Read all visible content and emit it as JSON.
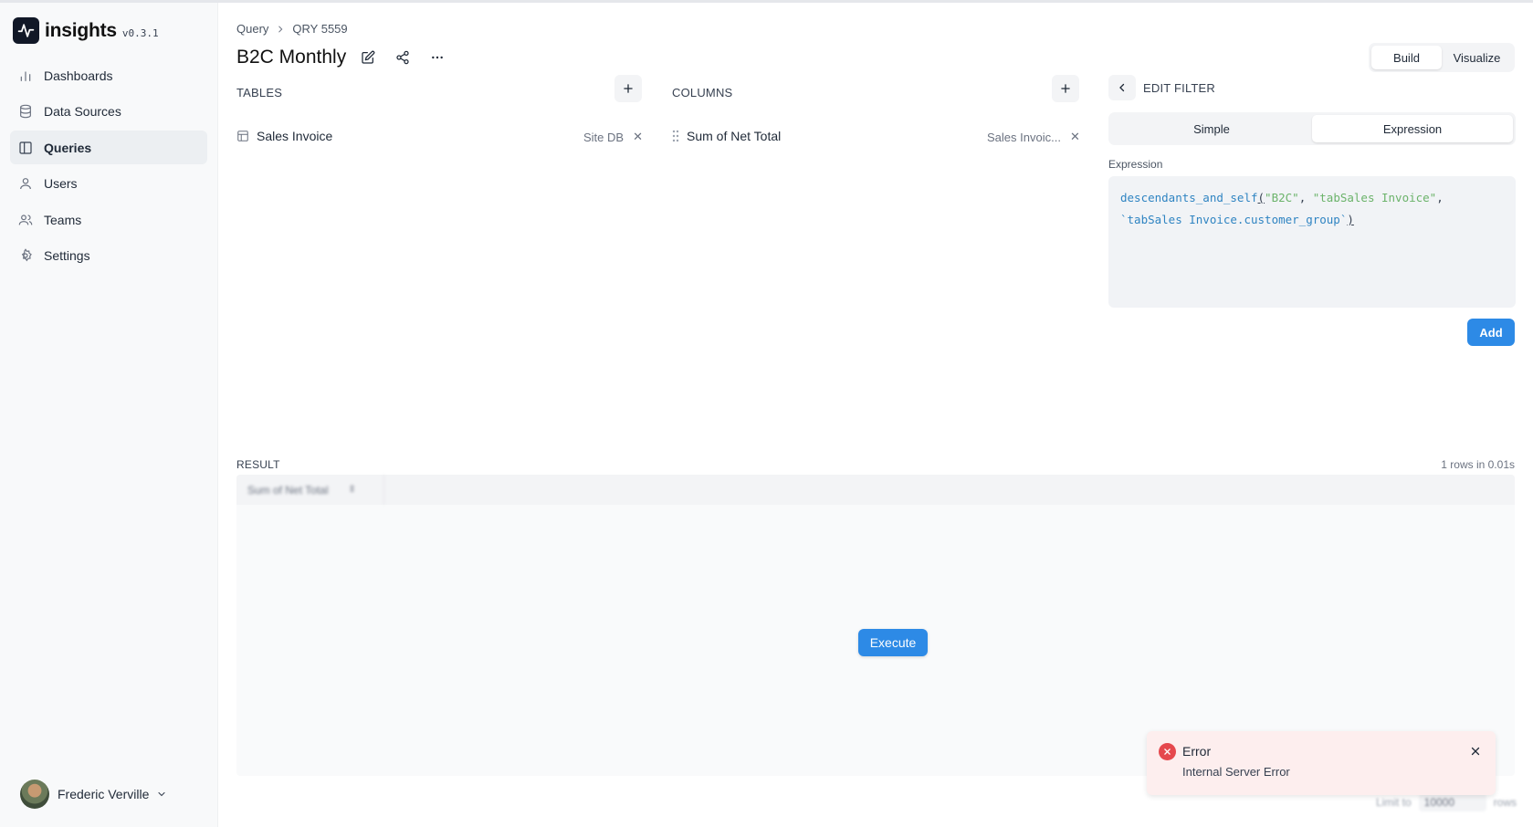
{
  "app": {
    "name": "insights",
    "version": "v0.3.1"
  },
  "sidebar": {
    "items": [
      {
        "label": "Dashboards",
        "icon": "bar-chart-icon"
      },
      {
        "label": "Data Sources",
        "icon": "database-icon"
      },
      {
        "label": "Queries",
        "icon": "columns-icon",
        "active": true
      },
      {
        "label": "Users",
        "icon": "user-icon"
      },
      {
        "label": "Teams",
        "icon": "users-icon"
      },
      {
        "label": "Settings",
        "icon": "gear-icon"
      }
    ],
    "user": {
      "name": "Frederic Verville"
    }
  },
  "header": {
    "breadcrumb": [
      "Query",
      "QRY 5559"
    ],
    "title": "B2C Monthly",
    "view_toggle": {
      "options": [
        "Build",
        "Visualize"
      ],
      "selected": "Build"
    }
  },
  "tables": {
    "label": "TABLES",
    "items": [
      {
        "name": "Sales Invoice",
        "source": "Site DB"
      }
    ]
  },
  "columns": {
    "label": "COLUMNS",
    "items": [
      {
        "name": "Sum of Net Total",
        "table": "Sales Invoic..."
      }
    ]
  },
  "filter": {
    "title": "EDIT FILTER",
    "tabs": [
      "Simple",
      "Expression"
    ],
    "selected_tab": "Expression",
    "expression_label": "Expression",
    "expression_fn": "descendants_and_self",
    "expression_args": [
      "\"B2C\"",
      "\"tabSales Invoice\"",
      "`tabSales Invoice.customer_group`"
    ],
    "add_label": "Add"
  },
  "result": {
    "label": "RESULT",
    "meta": "1 rows in 0.01s",
    "columns": [
      "Sum of Net Total"
    ],
    "execute_label": "Execute",
    "limit_prefix": "Limit to",
    "limit_value": "10000",
    "limit_suffix": "rows"
  },
  "toast": {
    "title": "Error",
    "message": "Internal Server Error",
    "color": "#e5484d"
  },
  "colors": {
    "accent": "#2d8ae6",
    "sidebar_bg": "#f8f9fa",
    "error_bg": "#fdeeee"
  }
}
